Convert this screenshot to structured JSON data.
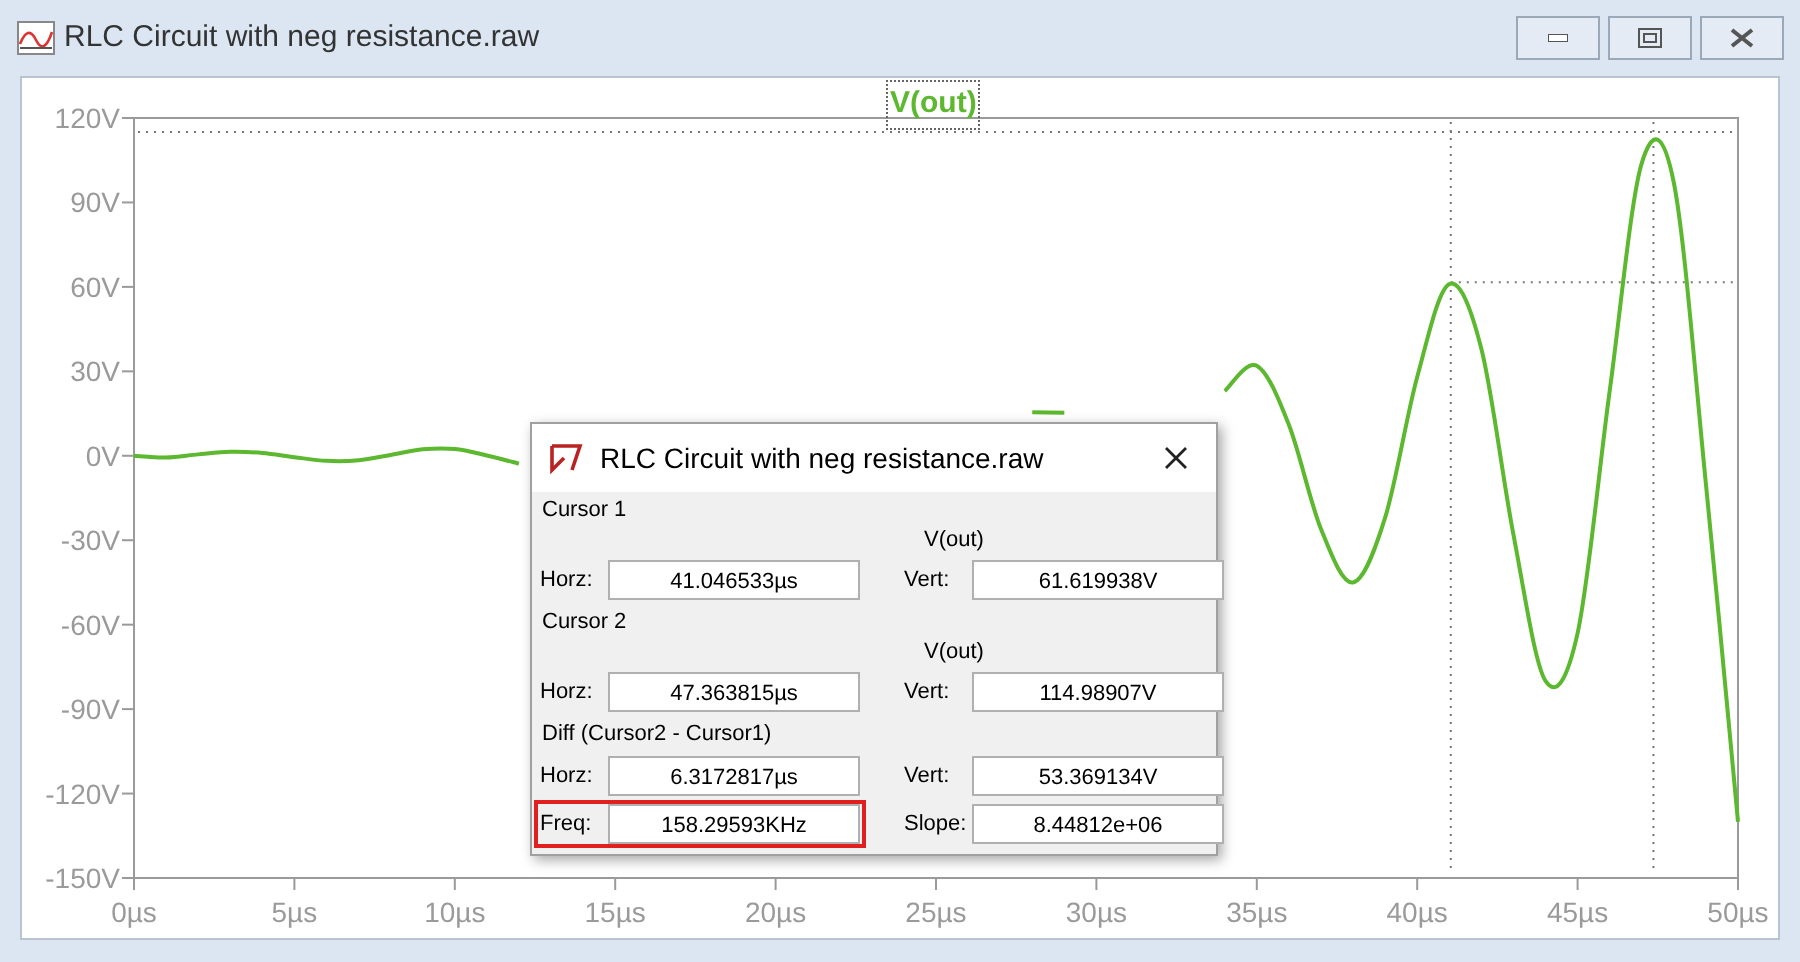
{
  "window": {
    "title": "RLC Circuit with neg resistance.raw"
  },
  "plot": {
    "chart_data": {
      "type": "line",
      "x": [
        0,
        1,
        2,
        3,
        4,
        5,
        6,
        7,
        8,
        9,
        10,
        11,
        12,
        13,
        14,
        15,
        16,
        17,
        18,
        19,
        20,
        21,
        22,
        23,
        24,
        25,
        26,
        27,
        28,
        29,
        30,
        31,
        32,
        33,
        34,
        35,
        36,
        37,
        38,
        39,
        40,
        41,
        42,
        43,
        44,
        45,
        46,
        47,
        48,
        49,
        50
      ],
      "series": [
        {
          "name": "V(out)",
          "color": "#5cb82e",
          "values": [
            0,
            -0.6,
            0.5,
            1.4,
            1.0,
            -0.5,
            -1.8,
            -1.6,
            0.3,
            2.3,
            2.4,
            0.1,
            -2.8,
            null,
            null,
            null,
            null,
            null,
            null,
            null,
            null,
            null,
            null,
            null,
            null,
            null,
            null,
            null,
            15.5,
            15.3,
            null,
            null,
            null,
            null,
            23,
            32,
            11,
            -26,
            -45,
            -22,
            28,
            61,
            38,
            -28,
            -80,
            -63,
            23,
            104,
            97,
            -10,
            -130
          ]
        }
      ],
      "xlim": [
        0,
        50
      ],
      "ylim": [
        -150,
        120
      ],
      "xticks": [
        {
          "value": 0,
          "label": "0µs"
        },
        {
          "value": 5,
          "label": "5µs"
        },
        {
          "value": 10,
          "label": "10µs"
        },
        {
          "value": 15,
          "label": "15µs"
        },
        {
          "value": 20,
          "label": "20µs"
        },
        {
          "value": 25,
          "label": "25µs"
        },
        {
          "value": 30,
          "label": "30µs"
        },
        {
          "value": 35,
          "label": "35µs"
        },
        {
          "value": 40,
          "label": "40µs"
        },
        {
          "value": 45,
          "label": "45µs"
        },
        {
          "value": 50,
          "label": "50µs"
        }
      ],
      "yticks": [
        {
          "value": 120,
          "label": "120V"
        },
        {
          "value": 90,
          "label": "90V"
        },
        {
          "value": 60,
          "label": "60V"
        },
        {
          "value": 30,
          "label": "30V"
        },
        {
          "value": 0,
          "label": "0V"
        },
        {
          "value": -30,
          "label": "-30V"
        },
        {
          "value": -60,
          "label": "-60V"
        },
        {
          "value": -90,
          "label": "-90V"
        },
        {
          "value": -120,
          "label": "-120V"
        },
        {
          "value": -150,
          "label": "-150V"
        }
      ]
    }
  },
  "cursor_dialog": {
    "title": "RLC Circuit with neg resistance.raw",
    "sections": [
      {
        "heading": "Cursor 1",
        "trace": "V(out)",
        "rows": [
          [
            {
              "label": "Horz:",
              "value": "41.046533µs",
              "highlighted": false
            },
            {
              "label": "Vert:",
              "value": "61.619938V",
              "highlighted": false
            }
          ]
        ]
      },
      {
        "heading": "Cursor 2",
        "trace": "V(out)",
        "rows": [
          [
            {
              "label": "Horz:",
              "value": "47.363815µs",
              "highlighted": false
            },
            {
              "label": "Vert:",
              "value": "114.98907V",
              "highlighted": false
            }
          ]
        ]
      },
      {
        "heading": "Diff (Cursor2 - Cursor1)",
        "rows": [
          [
            {
              "label": "Horz:",
              "value": "6.3172817µs",
              "highlighted": false
            },
            {
              "label": "Vert:",
              "value": "53.369134V",
              "highlighted": false
            }
          ],
          [
            {
              "label": "Freq:",
              "value": "158.29593KHz",
              "highlighted": true
            },
            {
              "label": "Slope:",
              "value": "8.44812e+06",
              "highlighted": false
            }
          ]
        ]
      }
    ]
  }
}
